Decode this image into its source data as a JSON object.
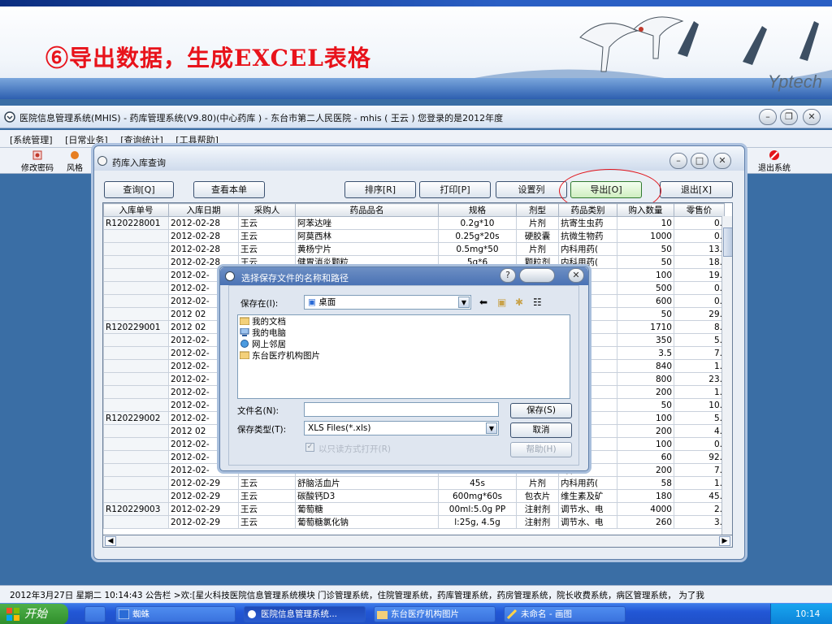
{
  "banner": {
    "title": "⑥导出数据，生成EXCEL表格",
    "logo": "Yptech"
  },
  "app": {
    "title": "医院信息管理系统(MHIS) - 药库管理系统(V9.80)(中心药库 ) - 东台市第二人民医院 - mhis ( 王云 ) 您登录的是2012年度",
    "menu": [
      "[系统管理]",
      "[日常业务]",
      "[查询统计]",
      "[工具帮助]"
    ],
    "toolbar": {
      "left1": "修改密码",
      "left2": "风格",
      "right": "退出系统"
    },
    "status": "2012年3月27日  星期二    10:14:43 公告栏   >欢:[星火科技医院信息管理系统模块   门诊管理系统，住院管理系统，药库管理系统，药房管理系统，院长收费系统，病区管理系统， 为了我"
  },
  "inventory": {
    "title": "药库入库查询",
    "buttons": {
      "query": "查询[Q]",
      "view_detail": "查看本单",
      "sort": "排序[R]",
      "print": "打印[P]",
      "set_columns": "设置列",
      "export": "导出[O]",
      "exit": "退出[X]"
    },
    "columns": [
      "入库单号",
      "入库日期",
      "采购人",
      "药品品名",
      "规格",
      "剂型",
      "药品类别",
      "购入数量",
      "零售价"
    ],
    "rows": [
      [
        "R120228001",
        "2012-02-28",
        "王云",
        "阿苯达唑",
        "0.2g*10",
        "片剂",
        "抗寄生虫药",
        "10",
        "0."
      ],
      [
        "",
        "2012-02-28",
        "王云",
        "阿莫西林",
        "0.25g*20s",
        "硬胶囊",
        "抗微生物药",
        "1000",
        "0."
      ],
      [
        "",
        "2012-02-28",
        "王云",
        "黄杨宁片",
        "0.5mg*50",
        "片剂",
        "内科用药(",
        "50",
        "13."
      ],
      [
        "",
        "2012-02-28",
        "王云",
        "健胃消炎颗粒",
        "5g*6",
        "颗粒剂",
        "内科用药(",
        "50",
        "18."
      ],
      [
        "",
        "2012-02-",
        "",
        "",
        "",
        "",
        "药(",
        "100",
        "19."
      ],
      [
        "",
        "2012-02-",
        "",
        "",
        "",
        "",
        "药",
        "500",
        "0."
      ],
      [
        "",
        "2012-02-",
        "",
        "",
        "",
        "",
        "及矿",
        "600",
        "0."
      ],
      [
        "",
        "2012 02",
        "",
        "",
        "",
        "",
        "药(",
        "50",
        "29."
      ],
      [
        "R120229001",
        "2012 02",
        "",
        "",
        "",
        "",
        "物药",
        "1710",
        "8."
      ],
      [
        "",
        "2012-02-",
        "",
        "",
        "",
        "",
        "物药",
        "350",
        "5."
      ],
      [
        "",
        "2012-02-",
        "",
        "",
        "",
        "",
        "物药",
        "3.5",
        "7."
      ],
      [
        "",
        "2012-02-",
        "",
        "",
        "",
        "",
        "系用",
        "840",
        "1."
      ],
      [
        "",
        "2012-02-",
        "",
        "",
        "",
        "",
        "物药",
        "800",
        "23."
      ],
      [
        "",
        "2012-02-",
        "",
        "",
        "",
        "",
        "及矿",
        "200",
        "1."
      ],
      [
        "",
        "2012-02-",
        "",
        "",
        "",
        "",
        "药(",
        "50",
        "10."
      ],
      [
        "R120229002",
        "2012-02-",
        "",
        "",
        "",
        "",
        "系用",
        "100",
        "5."
      ],
      [
        "",
        "2012 02",
        "",
        "",
        "",
        "",
        "药(",
        "200",
        "4."
      ],
      [
        "",
        "2012-02-",
        "",
        "",
        "",
        "",
        "药",
        "100",
        "0."
      ],
      [
        "",
        "2012-02-",
        "",
        "",
        "",
        "",
        "药(",
        "60",
        "92."
      ],
      [
        "",
        "2012-02-",
        "",
        "",
        "",
        "",
        "药(",
        "200",
        "7."
      ],
      [
        "",
        "2012-02-29",
        "王云",
        "舒脑活血片",
        "45s",
        "片剂",
        "内科用药(",
        "58",
        "1."
      ],
      [
        "",
        "2012-02-29",
        "王云",
        "碳酸钙D3",
        "600mg*60s",
        "包衣片",
        "维生素及矿",
        "180",
        "45."
      ],
      [
        "R120229003",
        "2012-02-29",
        "王云",
        "葡萄糖",
        "00ml:5.0g PP",
        "注射剂",
        "调节水、电",
        "4000",
        "2."
      ],
      [
        "",
        "2012-02-29",
        "王云",
        "葡萄糖氯化钠",
        "l:25g, 4.5g",
        "注射剂",
        "调节水、电",
        "260",
        "3."
      ]
    ]
  },
  "dialog": {
    "title": "选择保存文件的名称和路径",
    "save_in_label": "保存在(I):",
    "save_in_value": "桌面",
    "items": [
      "我的文档",
      "我的电脑",
      "网上邻居",
      "东台医疗机构图片"
    ],
    "file_name_label": "文件名(N):",
    "file_name_value": "",
    "file_type_label": "保存类型(T):",
    "file_type_value": "XLS Files(*.xls)",
    "readonly_label": "以只读方式打开(R)",
    "save_btn": "保存(S)",
    "cancel_btn": "取消",
    "help_btn": "帮助(H)"
  },
  "taskbar": {
    "start": "开始",
    "tasks": [
      "蜘蛛",
      "医院信息管理系统...",
      "东台医疗机构图片",
      "未命名 - 画图"
    ],
    "clock": "10:14"
  },
  "colors": {
    "accent_red": "#e8131b",
    "desktop_blue": "#3a6ea5",
    "taskbar_blue": "#2257d6"
  }
}
